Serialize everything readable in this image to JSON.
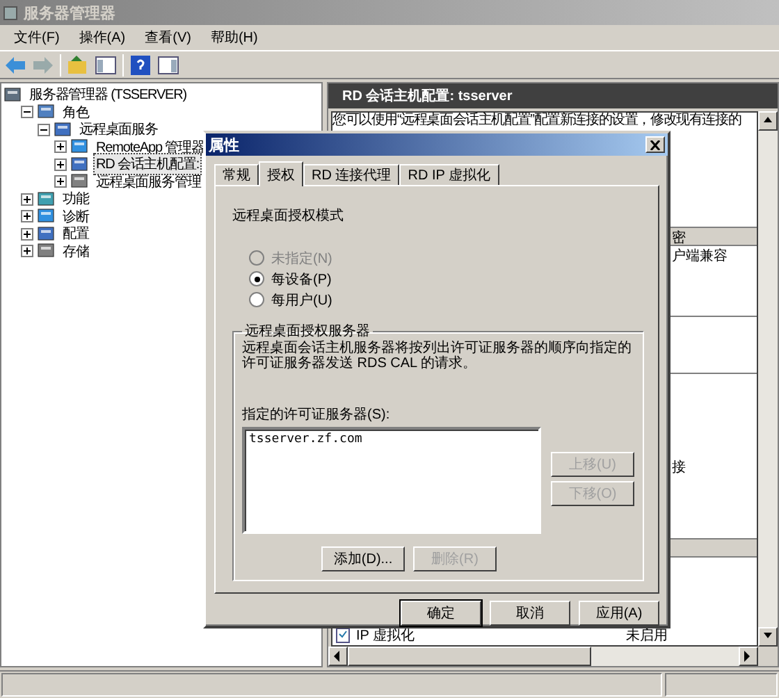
{
  "window": {
    "title": "服务器管理器"
  },
  "menu": [
    "文件(F)",
    "操作(A)",
    "查看(V)",
    "帮助(H)"
  ],
  "tree": [
    {
      "label": "服务器管理器 (TSSERVER)",
      "children": [
        {
          "label": "角色",
          "expanded": true,
          "children": [
            {
              "label": "远程桌面服务",
              "expanded": true,
              "children": [
                {
                  "label": "RemoteApp 管理器",
                  "expanded": false
                },
                {
                  "label": "RD 会话主机配置:",
                  "expanded": false,
                  "selected": true
                },
                {
                  "label": "远程桌面服务管理",
                  "expanded": false
                }
              ]
            }
          ]
        },
        {
          "label": "功能",
          "expanded": false
        },
        {
          "label": "诊断",
          "expanded": false
        },
        {
          "label": "配置",
          "expanded": false
        },
        {
          "label": "存储",
          "expanded": false
        }
      ]
    }
  ],
  "right_pane": {
    "header": "RD 会话主机配置: tsserver",
    "description": "您可以使用“远程桌面会话主机配置”配置新连接的设置，修改现有连接的",
    "fragments": [
      "密",
      "户端兼容",
      "接"
    ],
    "rows": [
      {
        "name": "IP 虚拟化",
        "value": "未启用"
      }
    ]
  },
  "dialog": {
    "title": "属性",
    "tabs": [
      {
        "label": "常规",
        "selected": false
      },
      {
        "label": "授权",
        "selected": true
      },
      {
        "label": "RD 连接代理",
        "selected": false
      },
      {
        "label": "RD IP 虚拟化",
        "selected": false
      }
    ],
    "mode_label": "远程桌面授权模式",
    "modes": [
      {
        "label": "未指定(N)",
        "selected": false,
        "disabled": true
      },
      {
        "label": "每设备(P)",
        "selected": true,
        "disabled": false
      },
      {
        "label": "每用户(U)",
        "selected": false,
        "disabled": false
      }
    ],
    "group": {
      "legend": "远程桌面授权服务器",
      "text": "远程桌面会话主机服务器将按列出许可证服务器的顺序向指定的许可证服务器发送 RDS CAL 的请求。",
      "list_label": "指定的许可证服务器(S):",
      "servers": [
        "tsserver.zf.com"
      ],
      "side_buttons": [
        {
          "label": "上移(U)",
          "disabled": true
        },
        {
          "label": "下移(O)",
          "disabled": true
        }
      ],
      "bottom_buttons": [
        {
          "label": "添加(D)...",
          "disabled": false
        },
        {
          "label": "删除(R)",
          "disabled": true
        }
      ]
    },
    "buttons": [
      {
        "label": "确定",
        "default": true
      },
      {
        "label": "取消",
        "default": false
      },
      {
        "label": "应用(A)",
        "default": false
      }
    ]
  }
}
